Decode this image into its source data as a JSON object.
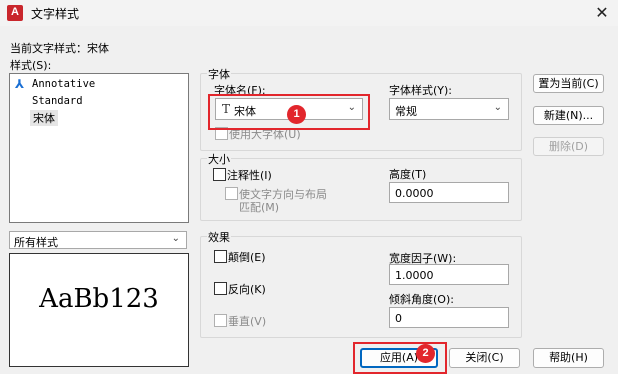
{
  "window": {
    "title": "文字样式",
    "app_icon_letter": "A",
    "close_glyph": "✕"
  },
  "current_style": {
    "label": "当前文字样式：",
    "value": "宋体"
  },
  "styles": {
    "label": "样式(S):",
    "items": [
      {
        "name": "Annotative",
        "icon": "annotative-icon",
        "icon_glyph": "⅄"
      },
      {
        "name": "Standard"
      },
      {
        "name": "宋体",
        "selected": true
      }
    ]
  },
  "filter": {
    "value": "所有样式"
  },
  "preview": {
    "text": "AaBb123"
  },
  "font": {
    "group_label": "字体",
    "name_label": "字体名(F):",
    "name_value": "宋体",
    "name_icon_glyph": "T",
    "style_label": "字体样式(Y):",
    "style_value": "常规",
    "bigfont_label": "使用大字体(U)"
  },
  "size": {
    "group_label": "大小",
    "annotative_label": "注释性(I)",
    "match_orientation_label_1": "使文字方向与布局",
    "match_orientation_label_2": "匹配(M)",
    "height_label": "高度(T)",
    "height_value": "0.0000"
  },
  "effects": {
    "group_label": "效果",
    "upside_down_label": "颠倒(E)",
    "backwards_label": "反向(K)",
    "vertical_label": "垂直(V)",
    "width_factor_label": "宽度因子(W):",
    "width_factor_value": "1.0000",
    "oblique_label": "倾斜角度(O):",
    "oblique_value": "0"
  },
  "buttons": {
    "set_current": "置为当前(C)",
    "new": "新建(N)...",
    "delete": "删除(D)",
    "apply": "应用(A)",
    "close": "关闭(C)",
    "help": "帮助(H)"
  },
  "annotations": {
    "badge_1": "1",
    "badge_2": "2",
    "accent_color": "#e2262c"
  }
}
